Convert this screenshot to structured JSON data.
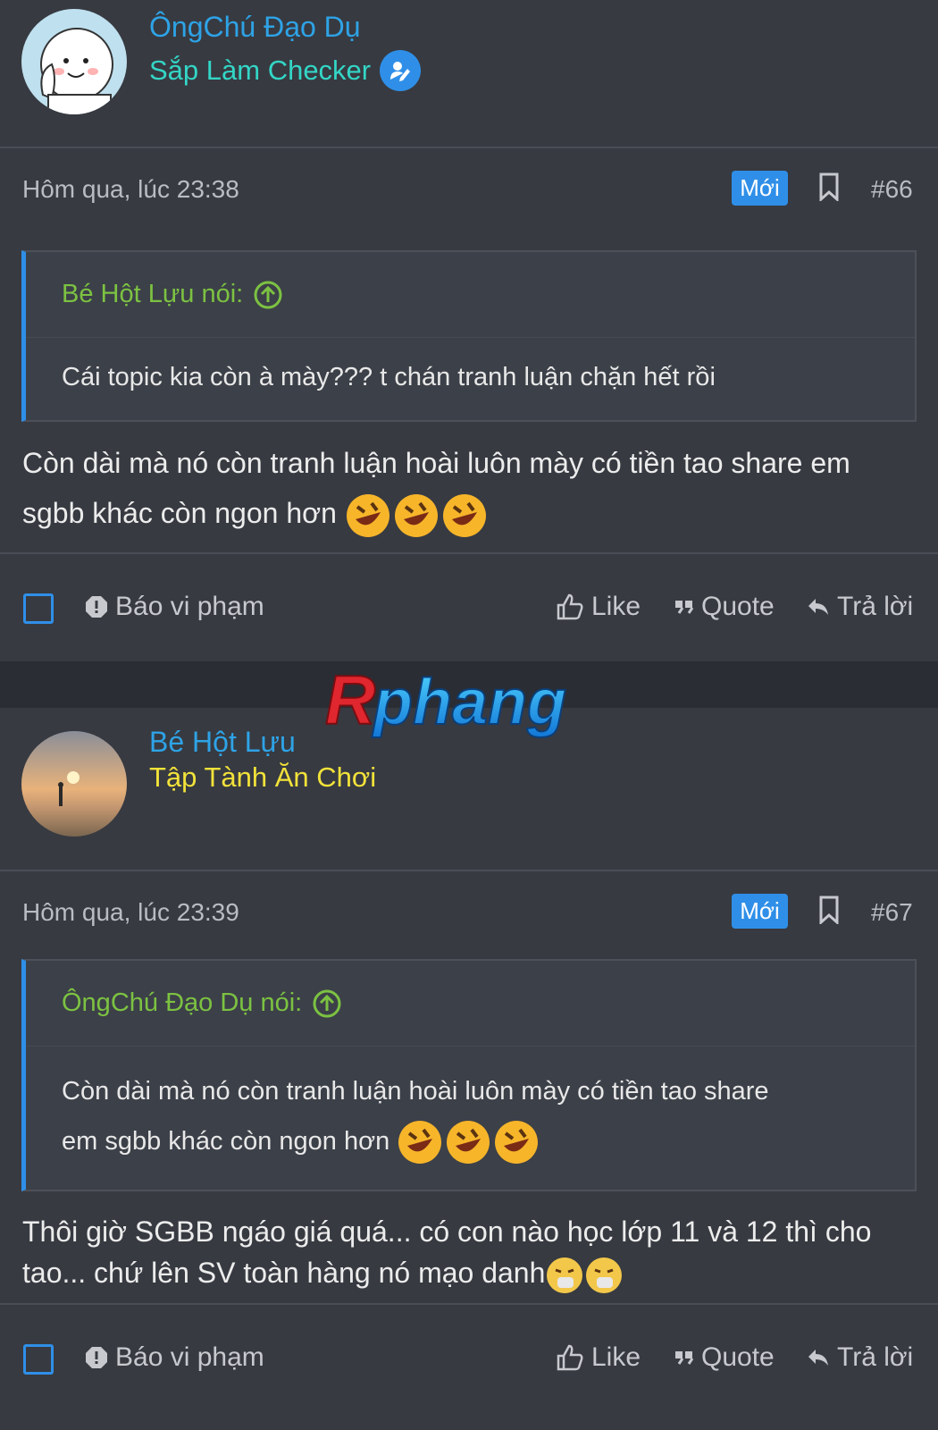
{
  "posts": [
    {
      "username": "ÔngChú Đạo Dụ",
      "user_title": "Sắp Làm Checker",
      "user_title_color": "#33d6c6",
      "timestamp": "Hôm qua, lúc 23:38",
      "new_badge": "Mới",
      "post_number": "#66",
      "quote_author": "Bé Hột Lựu nói:",
      "quote_text": "Cái topic kia còn à mày??? t chán tranh luận chặn hết rồi",
      "message_text": "Còn dài mà nó còn tranh luận hoài luôn mày có tiền tao share em sgbb khác còn ngon hơn"
    },
    {
      "username": "Bé Hột Lựu",
      "user_title": "Tập Tành Ăn Chơi",
      "user_title_color": "#f2e23a",
      "timestamp": "Hôm qua, lúc 23:39",
      "new_badge": "Mới",
      "post_number": "#67",
      "quote_author": "ÔngChú Đạo Dụ nói:",
      "quote_line1": "Còn dài mà nó còn tranh luận hoài luôn mày có tiền tao share",
      "quote_line2": "em sgbb khác còn ngon hơn",
      "message_line1": "Thôi giờ SGBB ngáo giá quá... có con nào học lớp 11 và 12 thì cho",
      "message_line2": "tao... chứ lên SV toàn hàng nó mạo danh"
    }
  ],
  "actions": {
    "report": "Báo vi phạm",
    "like": "Like",
    "quote": "Quote",
    "reply": "Trả lời"
  },
  "watermark": "Rphang",
  "icons": {
    "badge": "verified-user-icon",
    "bookmark": "bookmark-icon",
    "quote_up": "arrow-up-circle-icon",
    "report": "alert-icon",
    "like": "thumbs-up-icon",
    "quote": "quote-marks-icon",
    "reply": "reply-arrow-icon",
    "emoji": "rofl-emoji",
    "emoji2": "sneezing-face-emoji"
  },
  "colors": {
    "accent": "#2f8fe8",
    "username": "#2ea3e6",
    "quote_author": "#7cc242"
  }
}
